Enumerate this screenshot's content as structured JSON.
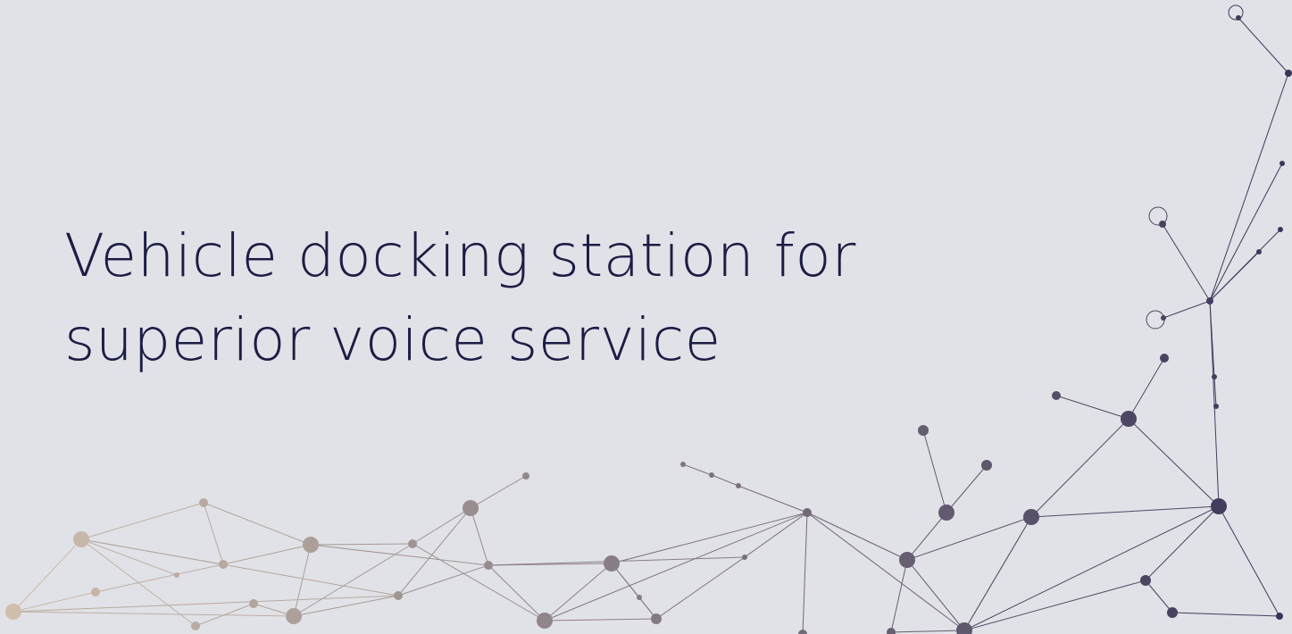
{
  "slide": {
    "title": "Vehicle docking station for superior voice service"
  },
  "colors": {
    "background": "#e1e2e7",
    "title": "#1b1d45",
    "network_light": "#cfc0ad",
    "network_dark": "#3a3558"
  }
}
